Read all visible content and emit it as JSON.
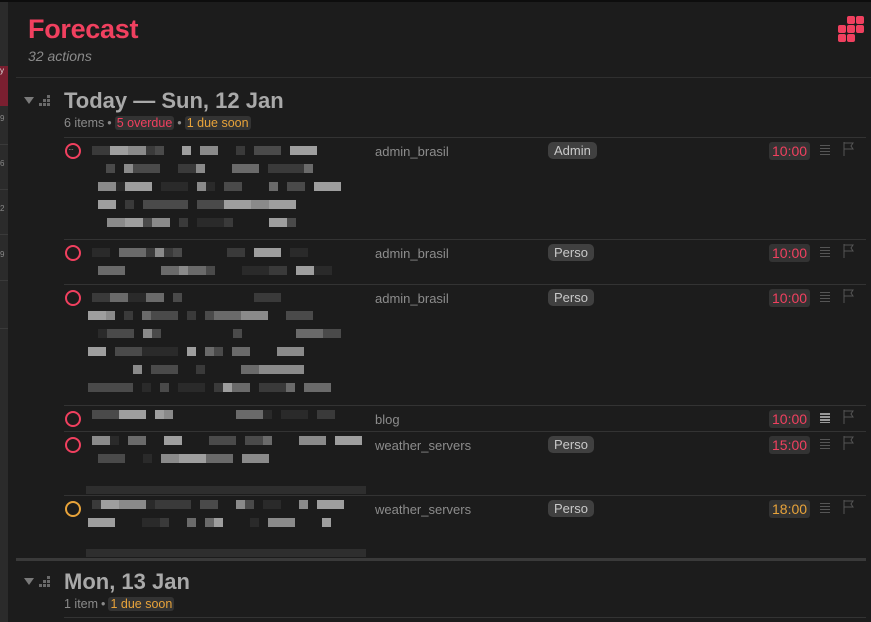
{
  "window": {
    "title": "Forecast"
  },
  "header": {
    "title": "Forecast",
    "subtitle": "32 actions",
    "icon": "forecast-grid-icon",
    "accent_color": "#f0405f"
  },
  "sidebar_strip": {
    "items": [
      "y",
      "9",
      "6",
      "2",
      "9"
    ]
  },
  "groups": [
    {
      "title": "Today — Sun, 12 Jan",
      "item_count": "6 items",
      "overdue": "5 overdue",
      "due_soon": "1 due soon",
      "tasks": [
        {
          "title": "[redacted]",
          "project": "admin_brasil",
          "tag": "Admin",
          "time": "10:00",
          "status": "overdue",
          "note": false,
          "has_menu": true
        },
        {
          "title": "[redacted]",
          "project": "admin_brasil",
          "tag": "Perso",
          "time": "10:00",
          "status": "overdue",
          "note": false
        },
        {
          "title": "[redacted]",
          "project": "admin_brasil",
          "tag": "Perso",
          "time": "10:00",
          "status": "overdue",
          "note": false
        },
        {
          "title": "[redacted]",
          "project": "blog",
          "tag": "",
          "time": "10:00",
          "status": "overdue",
          "note": true
        },
        {
          "title": "[redacted]",
          "project": "weather_servers",
          "tag": "Perso",
          "time": "15:00",
          "status": "overdue",
          "note": false
        },
        {
          "title": "[redacted]",
          "project": "weather_servers",
          "tag": "Perso",
          "time": "18:00",
          "status": "due_soon",
          "note": false
        }
      ]
    },
    {
      "title": "Mon, 13 Jan",
      "item_count": "1 item",
      "due_soon": "1 due soon",
      "tasks": []
    }
  ],
  "colors": {
    "overdue": "#f0405f",
    "due_soon": "#e8a33a",
    "background": "#1c1c1c"
  }
}
